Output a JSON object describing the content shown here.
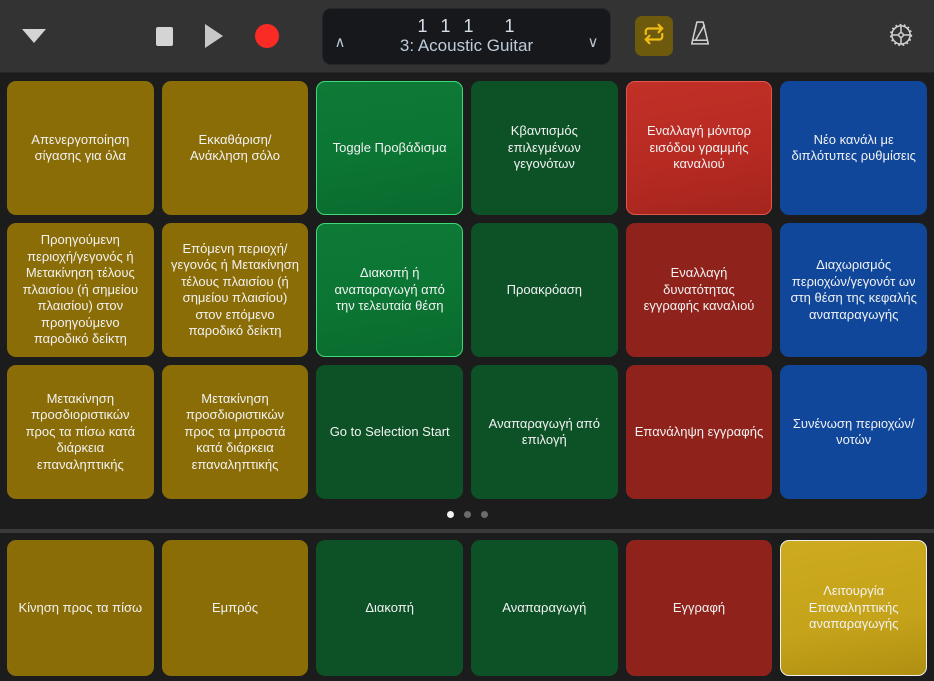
{
  "toolbar": {
    "menu_icon": "chevron-down-icon",
    "stop_label": "Stop",
    "play_label": "Play",
    "record_label": "Record",
    "lcd": {
      "position": "1  1  1     1",
      "track_name": "3: Acoustic Guitar",
      "up_chevron": "∧",
      "down_chevron": "∨"
    },
    "cycle_label": "Cycle",
    "metronome_label": "Metronome",
    "settings_label": "Settings"
  },
  "colors": {
    "yellow": "#8a6d06",
    "green": "#0d5227",
    "red": "#8f231c",
    "blue": "#10479a",
    "green_highlight": "#0b7533",
    "red_highlight": "#b52a22",
    "yellow_highlight": "#c5a31a",
    "cycle_active": "#6e5a0c",
    "record_red": "#fa2b24",
    "toolbar_bg": "#333333",
    "page_bg": "#1c1c1c",
    "lcd_bg": "#16181c"
  },
  "grid": {
    "pads": [
      {
        "label": "Απενεργοποίηση σίγασης για όλα",
        "color": "yellow",
        "highlighted": false
      },
      {
        "label": "Εκκαθάριση/ Ανάκληση σόλο",
        "color": "yellow",
        "highlighted": false
      },
      {
        "label": "Toggle Προβάδισμα",
        "color": "green",
        "highlighted": true
      },
      {
        "label": "Κβαντισμός επιλεγμένων γεγονότων",
        "color": "green",
        "highlighted": false
      },
      {
        "label": "Εναλλαγή μόνιτορ εισόδου γραμμής καναλιού",
        "color": "red",
        "highlighted": true
      },
      {
        "label": "Νέο κανάλι με διπλότυπες ρυθμίσεις",
        "color": "blue",
        "highlighted": false
      },
      {
        "label": "Προηγούμενη περιοχή/γεγονός ή Μετακίνηση τέλους πλαισίου (ή σημείου πλαισίου) στον προηγούμενο παροδικό δείκτη",
        "color": "yellow",
        "highlighted": false
      },
      {
        "label": "Επόμενη περιοχή/γεγονός ή Μετακίνηση τέλους πλαισίου (ή σημείου πλαισίου) στον επόμενο παροδικό δείκτη",
        "color": "yellow",
        "highlighted": false
      },
      {
        "label": "Διακοπή ή αναπαραγωγή από την τελευταία θέση",
        "color": "green",
        "highlighted": true
      },
      {
        "label": "Προακρόαση",
        "color": "green",
        "highlighted": false
      },
      {
        "label": "Εναλλαγή δυνατότητας εγγραφής καναλιού",
        "color": "red",
        "highlighted": false
      },
      {
        "label": "Διαχωρισμός περιοχών/γεγονότ ων στη θέση της κεφαλής αναπαραγωγής",
        "color": "blue",
        "highlighted": false
      },
      {
        "label": "Μετακίνηση προσδιοριστικών προς τα πίσω κατά διάρκεια επαναληπτικής",
        "color": "yellow",
        "highlighted": false
      },
      {
        "label": "Μετακίνηση προσδιοριστικών προς τα μπροστά κατά διάρκεια επαναληπτικής",
        "color": "yellow",
        "highlighted": false
      },
      {
        "label": "Go to Selection Start",
        "color": "green",
        "highlighted": false
      },
      {
        "label": "Αναπαραγωγή από επιλογή",
        "color": "green",
        "highlighted": false
      },
      {
        "label": "Επανάληψη εγγραφής",
        "color": "red",
        "highlighted": false
      },
      {
        "label": "Συνένωση περιοχών/νοτών",
        "color": "blue",
        "highlighted": false
      }
    ]
  },
  "pagination": {
    "total": 3,
    "active_index": 0
  },
  "transport": {
    "pads": [
      {
        "label": "Κίνηση προς τα πίσω",
        "color": "yellow",
        "highlighted": false
      },
      {
        "label": "Εμπρός",
        "color": "yellow",
        "highlighted": false
      },
      {
        "label": "Διακοπή",
        "color": "green",
        "highlighted": false
      },
      {
        "label": "Αναπαραγωγή",
        "color": "green",
        "highlighted": false
      },
      {
        "label": "Εγγραφή",
        "color": "red",
        "highlighted": false
      },
      {
        "label": "Λειτουργία Επαναληπτικής αναπαραγωγής",
        "color": "yellow",
        "highlighted": true
      }
    ]
  }
}
